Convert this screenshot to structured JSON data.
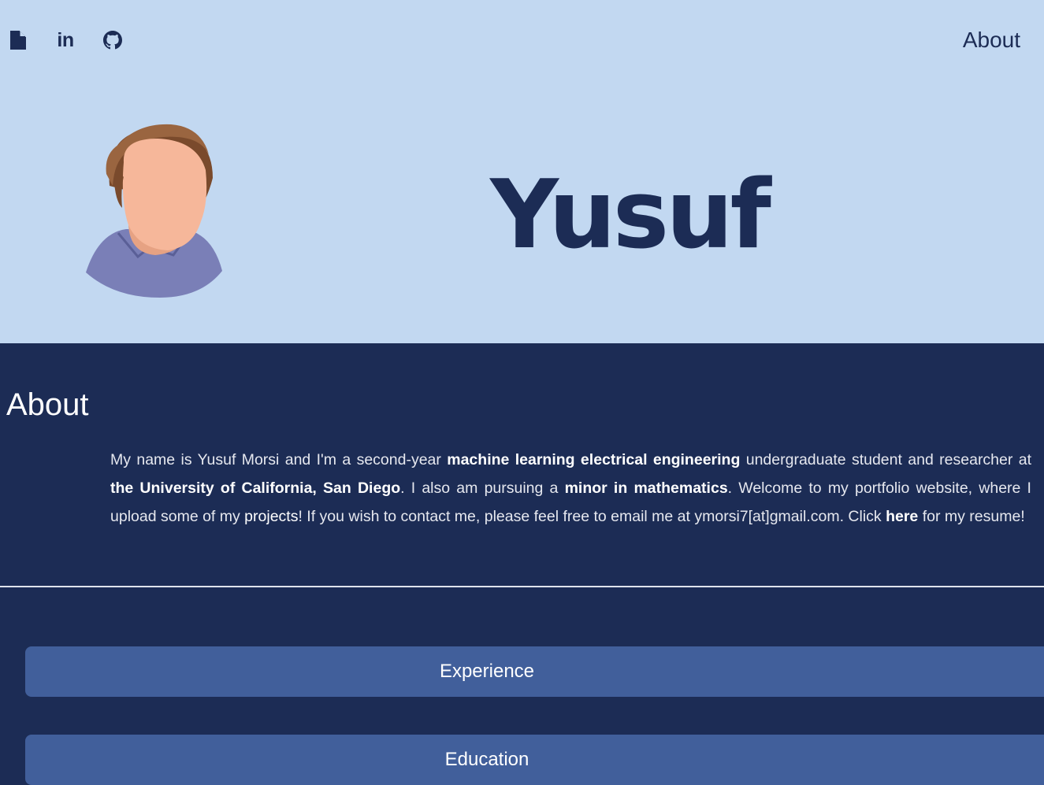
{
  "header": {
    "social_icons": [
      {
        "name": "resume-file-icon"
      },
      {
        "name": "linkedin-icon",
        "text": "in"
      },
      {
        "name": "github-icon"
      }
    ],
    "nav_about": "About",
    "name": "Yusuf"
  },
  "about": {
    "heading": "About",
    "t1": "My name is Yusuf Morsi and I'm a second-year ",
    "b1": "machine learning electrical engineering",
    "t2": " undergraduate student and researcher at ",
    "b2": "the University of California, San Diego",
    "t3": ". I also am pursuing a ",
    "b3": "minor in mathematics",
    "t4": ". Welcome to my portfolio website, where I upload some of my ",
    "link_projects": "projects",
    "t5": "! If you wish to contact me, please feel free to email me at ymorsi7[at]gmail.com. Click ",
    "link_here": "here",
    "t6": " for my resume!"
  },
  "sections": {
    "experience": "Experience",
    "education": "Education"
  },
  "colors": {
    "header_bg": "#c2d8f1",
    "navy": "#1c2c55",
    "accordion": "#415f9b"
  }
}
